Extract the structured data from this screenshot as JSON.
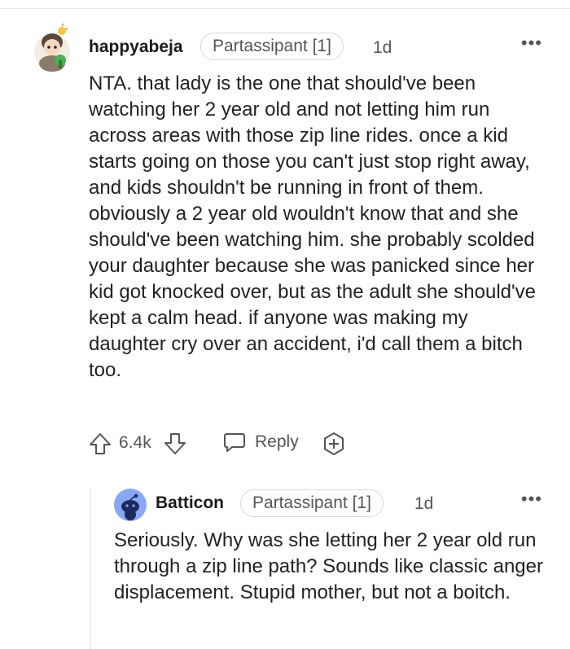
{
  "post": {
    "username": "happyabeja",
    "flair": "Partassipant [1]",
    "age": "1d",
    "more_label": "•••",
    "body": "NTA. that lady is the one that should've been watching her 2 year old and not letting him run across areas with those zip line rides. once a kid starts going on those you can't just stop right away, and kids shouldn't be running in front of them. obviously a 2 year old wouldn't know that and she should've been watching him. she probably scolded your daughter because she was panicked since her kid got knocked over, but as the adult she should've kept a calm head. if anyone was making my daughter cry over an accident, i'd call them a bitch too.",
    "score": "6.4k",
    "reply_label": "Reply",
    "icons": {
      "upvote": "arrow-up-icon",
      "downvote": "arrow-down-icon",
      "reply": "speech-bubble-icon",
      "award": "award-plus-icon",
      "avatar": "snoo-avatar-icon"
    }
  },
  "reply": {
    "username": "Batticon",
    "flair": "Partassipant [1]",
    "age": "1d",
    "more_label": "•••",
    "body": "Seriously. Why was she letting her 2 year old run through a zip line path? Sounds like classic anger displacement. Stupid mother, but not a boitch.",
    "icons": {
      "avatar": "default-snoo-avatar-icon"
    }
  },
  "colors": {
    "text": "#1c1c1c",
    "meta": "#555555",
    "border": "#d9d9d9",
    "avatar_blue": "#8aa7f5"
  }
}
